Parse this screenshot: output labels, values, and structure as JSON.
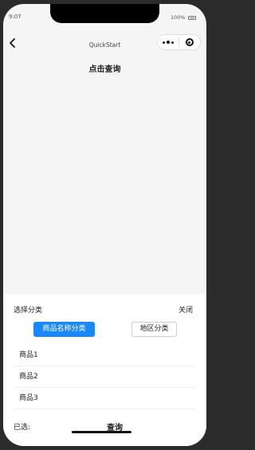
{
  "status_bar": {
    "time": "9:07",
    "battery": "100%"
  },
  "nav": {
    "title": "QuickStart"
  },
  "main": {
    "query_label": "点击查询"
  },
  "sheet": {
    "title": "选择分类",
    "close_label": "关闭",
    "categories": [
      {
        "label": "商品名称分类",
        "active": true
      },
      {
        "label": "地区分类",
        "active": false
      }
    ],
    "products": [
      "商品1",
      "商品2",
      "商品3"
    ],
    "selected_label": "已选:",
    "query_button": "查询"
  },
  "colors": {
    "accent": "#1989fa",
    "page_bg": "#f5f5f5"
  },
  "icons": [
    "back-arrow-icon",
    "more-dots-icon",
    "target-icon",
    "battery-icon"
  ]
}
